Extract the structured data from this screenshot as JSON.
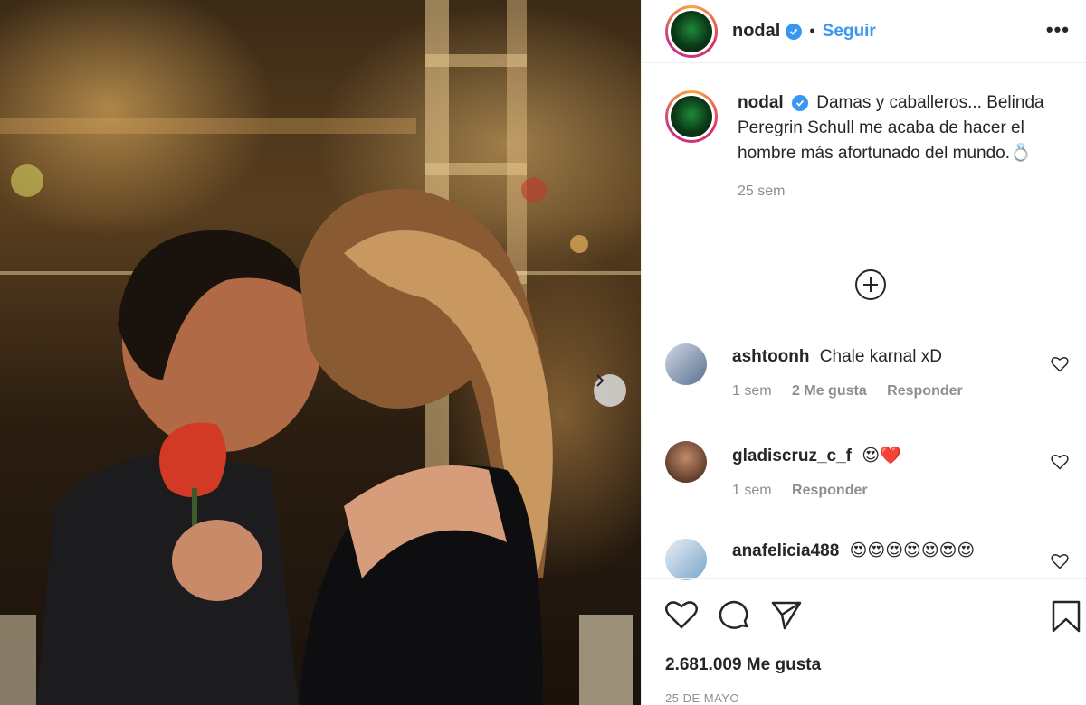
{
  "post": {
    "username": "nodal",
    "follow_label": "Seguir",
    "more_label": "•••",
    "caption": {
      "username": "nodal",
      "text": "Damas y caballeros... Belinda Peregrin Schull me acaba de hacer el hombre más afortunado del mundo.💍",
      "time": "25 sem"
    },
    "comments": [
      {
        "username": "ashtoonh",
        "text": "Chale karnal xD",
        "time": "1 sem",
        "likes": "2 Me gusta",
        "reply": "Responder"
      },
      {
        "username": "gladiscruz_c_f",
        "text": "😍❤️",
        "time": "1 sem",
        "reply": "Responder"
      },
      {
        "username": "anafelicia488",
        "text": "😍😍😍😍😍😍😍"
      }
    ],
    "likes_count": "2.681.009 Me gusta",
    "date": "25 DE MAYO"
  },
  "icons": {
    "verified": "verified-badge-icon",
    "more": "more-options-icon",
    "load_more": "plus-circle-icon",
    "carousel_next": "chevron-right-icon",
    "like": "heart-icon",
    "comment": "comment-bubble-icon",
    "share": "paper-plane-icon",
    "save": "bookmark-icon"
  },
  "colors": {
    "accent": "#3897f0",
    "text": "#262626",
    "muted": "#8e8e8e",
    "border": "#efefef"
  }
}
